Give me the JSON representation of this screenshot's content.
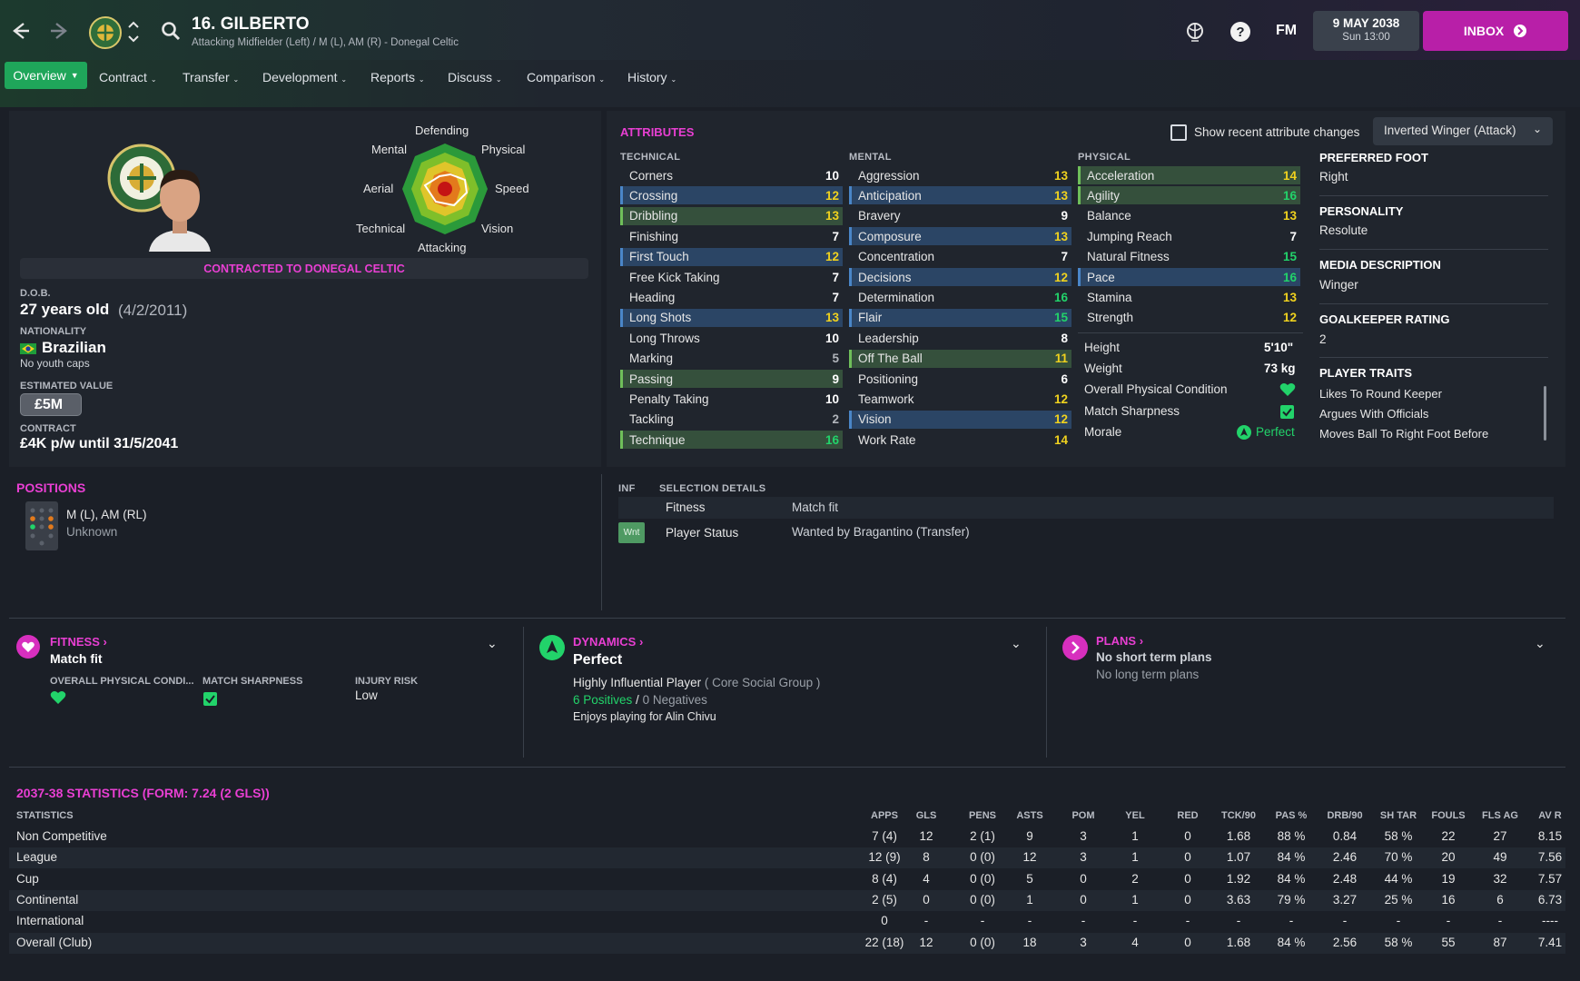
{
  "header": {
    "title": "16. GILBERTO",
    "subtitle": "Attacking Midfielder (Left) / M (L), AM (R) - Donegal Celtic",
    "date": "9 MAY 2038",
    "time": "Sun 13:00",
    "inbox_label": "INBOX",
    "fm_label": "FM"
  },
  "tabs": [
    {
      "label": "Overview"
    },
    {
      "label": "Contract"
    },
    {
      "label": "Transfer"
    },
    {
      "label": "Development"
    },
    {
      "label": "Reports"
    },
    {
      "label": "Discuss"
    },
    {
      "label": "Comparison"
    },
    {
      "label": "History"
    }
  ],
  "profile": {
    "radar_labels": {
      "defending": "Defending",
      "physical": "Physical",
      "speed": "Speed",
      "vision": "Vision",
      "attacking": "Attacking",
      "technical": "Technical",
      "aerial": "Aerial",
      "mental": "Mental"
    },
    "contract_banner": "CONTRACTED TO DONEGAL CELTIC",
    "dob_label": "D.O.B.",
    "age": "27 years old",
    "dob": "(4/2/2011)",
    "nationality_label": "NATIONALITY",
    "nationality": "Brazilian",
    "youth_caps": "No youth caps",
    "value_label": "ESTIMATED VALUE",
    "value": "£5M",
    "contract_label": "CONTRACT",
    "contract": "£4K p/w until 31/5/2041"
  },
  "attributes": {
    "title": "ATTRIBUTES",
    "show_changes_label": "Show recent attribute changes",
    "role_select": "Inverted Winger (Attack)",
    "technical_label": "TECHNICAL",
    "mental_label": "MENTAL",
    "physical_label": "PHYSICAL",
    "technical": [
      {
        "name": "Corners",
        "value": "10",
        "hl": ""
      },
      {
        "name": "Crossing",
        "value": "12",
        "hl": "blue"
      },
      {
        "name": "Dribbling",
        "value": "13",
        "hl": "green"
      },
      {
        "name": "Finishing",
        "value": "7",
        "hl": ""
      },
      {
        "name": "First Touch",
        "value": "12",
        "hl": "blue"
      },
      {
        "name": "Free Kick Taking",
        "value": "7",
        "hl": ""
      },
      {
        "name": "Heading",
        "value": "7",
        "hl": ""
      },
      {
        "name": "Long Shots",
        "value": "13",
        "hl": "blue"
      },
      {
        "name": "Long Throws",
        "value": "10",
        "hl": ""
      },
      {
        "name": "Marking",
        "value": "5",
        "hl": ""
      },
      {
        "name": "Passing",
        "value": "9",
        "hl": "green"
      },
      {
        "name": "Penalty Taking",
        "value": "10",
        "hl": ""
      },
      {
        "name": "Tackling",
        "value": "2",
        "hl": ""
      },
      {
        "name": "Technique",
        "value": "16",
        "hl": "green"
      }
    ],
    "mental": [
      {
        "name": "Aggression",
        "value": "13",
        "hl": ""
      },
      {
        "name": "Anticipation",
        "value": "13",
        "hl": "blue"
      },
      {
        "name": "Bravery",
        "value": "9",
        "hl": ""
      },
      {
        "name": "Composure",
        "value": "13",
        "hl": "blue"
      },
      {
        "name": "Concentration",
        "value": "7",
        "hl": ""
      },
      {
        "name": "Decisions",
        "value": "12",
        "hl": "blue"
      },
      {
        "name": "Determination",
        "value": "16",
        "hl": ""
      },
      {
        "name": "Flair",
        "value": "15",
        "hl": "blue"
      },
      {
        "name": "Leadership",
        "value": "8",
        "hl": ""
      },
      {
        "name": "Off The Ball",
        "value": "11",
        "hl": "green"
      },
      {
        "name": "Positioning",
        "value": "6",
        "hl": ""
      },
      {
        "name": "Teamwork",
        "value": "12",
        "hl": ""
      },
      {
        "name": "Vision",
        "value": "12",
        "hl": "blue"
      },
      {
        "name": "Work Rate",
        "value": "14",
        "hl": ""
      }
    ],
    "physical": [
      {
        "name": "Acceleration",
        "value": "14",
        "hl": "green"
      },
      {
        "name": "Agility",
        "value": "16",
        "hl": "green"
      },
      {
        "name": "Balance",
        "value": "13",
        "hl": ""
      },
      {
        "name": "Jumping Reach",
        "value": "7",
        "hl": ""
      },
      {
        "name": "Natural Fitness",
        "value": "15",
        "hl": ""
      },
      {
        "name": "Pace",
        "value": "16",
        "hl": "blue"
      },
      {
        "name": "Stamina",
        "value": "13",
        "hl": ""
      },
      {
        "name": "Strength",
        "value": "12",
        "hl": ""
      }
    ],
    "height_label": "Height",
    "height": "5'10\"",
    "weight_label": "Weight",
    "weight": "73 kg",
    "condition_label": "Overall Physical Condition",
    "sharpness_label": "Match Sharpness",
    "morale_label": "Morale",
    "morale": "Perfect"
  },
  "side_info": {
    "foot_label": "PREFERRED FOOT",
    "foot": "Right",
    "personality_label": "PERSONALITY",
    "personality": "Resolute",
    "media_label": "MEDIA DESCRIPTION",
    "media": "Winger",
    "gk_label": "GOALKEEPER RATING",
    "gk": "2",
    "traits_label": "PLAYER TRAITS",
    "traits": [
      "Likes To Round Keeper",
      "Argues With Officials",
      "Moves Ball To Right Foot Before"
    ]
  },
  "positions": {
    "title": "POSITIONS",
    "positions": "M (L), AM (RL)",
    "familiarity": "Unknown"
  },
  "selection": {
    "inf_label": "INF",
    "details_label": "SELECTION DETAILS",
    "fitness_label": "Fitness",
    "fitness": "Match fit",
    "badge": "Wnt",
    "status_label": "Player Status",
    "status": "Wanted by Bragantino (Transfer)"
  },
  "fitness_panel": {
    "title": "FITNESS",
    "value": "Match fit",
    "condition_label": "OVERALL PHYSICAL CONDI...",
    "sharpness_label": "MATCH SHARPNESS",
    "injury_label": "INJURY RISK",
    "injury": "Low"
  },
  "dynamics_panel": {
    "title": "DYNAMICS",
    "value": "Perfect",
    "influence": "Highly Influential Player",
    "group": "( Core Social Group )",
    "positives": "6 Positives",
    "slash": "/",
    "negatives": "0 Negatives",
    "note": "Enjoys playing for Alin Chivu"
  },
  "plans_panel": {
    "title": "PLANS",
    "short": "No short term plans",
    "long": "No long term plans"
  },
  "stats": {
    "title": "2037-38 STATISTICS (FORM: 7.24 (2 GLS))",
    "columns": [
      "STATISTICS",
      "APPS",
      "GLS",
      "PENS",
      "ASTS",
      "POM",
      "YEL",
      "RED",
      "TCK/90",
      "PAS %",
      "DRB/90",
      "SH TAR",
      "FOULS",
      "FLS AG",
      "AV R"
    ],
    "rows": [
      [
        "Non Competitive",
        "7 (4)",
        "12",
        "2 (1)",
        "9",
        "3",
        "1",
        "0",
        "1.68",
        "88 %",
        "0.84",
        "58 %",
        "22",
        "27",
        "8.15"
      ],
      [
        "League",
        "12 (9)",
        "8",
        "0 (0)",
        "12",
        "3",
        "1",
        "0",
        "1.07",
        "84 %",
        "2.46",
        "70 %",
        "20",
        "49",
        "7.56"
      ],
      [
        "Cup",
        "8 (4)",
        "4",
        "0 (0)",
        "5",
        "0",
        "2",
        "0",
        "1.92",
        "84 %",
        "2.48",
        "44 %",
        "19",
        "32",
        "7.57"
      ],
      [
        "Continental",
        "2 (5)",
        "0",
        "0 (0)",
        "1",
        "0",
        "1",
        "0",
        "3.63",
        "79 %",
        "3.27",
        "25 %",
        "16",
        "6",
        "6.73"
      ],
      [
        "International",
        "0",
        "-",
        "-",
        "-",
        "-",
        "-",
        "-",
        "-",
        "-",
        "-",
        "-",
        "-",
        "-",
        "----"
      ],
      [
        "Overall (Club)",
        "22 (18)",
        "12",
        "0 (0)",
        "18",
        "3",
        "4",
        "0",
        "1.68",
        "84 %",
        "2.56",
        "58 %",
        "55",
        "87",
        "7.41"
      ]
    ]
  },
  "colors": {
    "accent": "#e93fd3",
    "good": "#22d36a",
    "high": "#f0d21e",
    "tab_active": "#1fa65a"
  }
}
